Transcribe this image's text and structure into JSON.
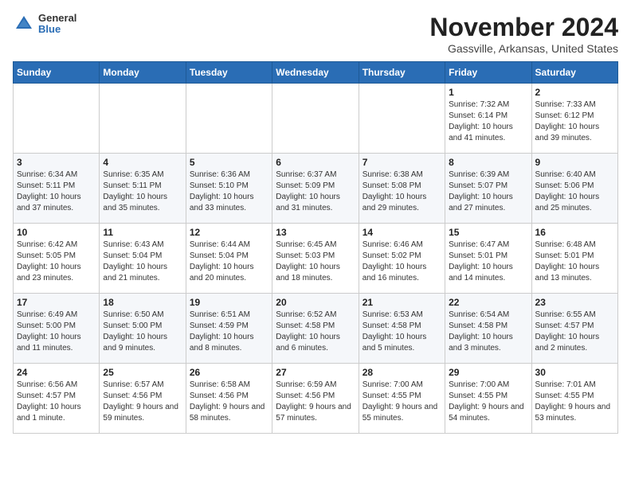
{
  "header": {
    "logo_general": "General",
    "logo_blue": "Blue",
    "month_title": "November 2024",
    "location": "Gassville, Arkansas, United States"
  },
  "weekdays": [
    "Sunday",
    "Monday",
    "Tuesday",
    "Wednesday",
    "Thursday",
    "Friday",
    "Saturday"
  ],
  "weeks": [
    [
      null,
      null,
      null,
      null,
      null,
      {
        "day": "1",
        "sunrise": "Sunrise: 7:32 AM",
        "sunset": "Sunset: 6:14 PM",
        "daylight": "Daylight: 10 hours and 41 minutes."
      },
      {
        "day": "2",
        "sunrise": "Sunrise: 7:33 AM",
        "sunset": "Sunset: 6:12 PM",
        "daylight": "Daylight: 10 hours and 39 minutes."
      }
    ],
    [
      {
        "day": "3",
        "sunrise": "Sunrise: 6:34 AM",
        "sunset": "Sunset: 5:11 PM",
        "daylight": "Daylight: 10 hours and 37 minutes."
      },
      {
        "day": "4",
        "sunrise": "Sunrise: 6:35 AM",
        "sunset": "Sunset: 5:11 PM",
        "daylight": "Daylight: 10 hours and 35 minutes."
      },
      {
        "day": "5",
        "sunrise": "Sunrise: 6:36 AM",
        "sunset": "Sunset: 5:10 PM",
        "daylight": "Daylight: 10 hours and 33 minutes."
      },
      {
        "day": "6",
        "sunrise": "Sunrise: 6:37 AM",
        "sunset": "Sunset: 5:09 PM",
        "daylight": "Daylight: 10 hours and 31 minutes."
      },
      {
        "day": "7",
        "sunrise": "Sunrise: 6:38 AM",
        "sunset": "Sunset: 5:08 PM",
        "daylight": "Daylight: 10 hours and 29 minutes."
      },
      {
        "day": "8",
        "sunrise": "Sunrise: 6:39 AM",
        "sunset": "Sunset: 5:07 PM",
        "daylight": "Daylight: 10 hours and 27 minutes."
      },
      {
        "day": "9",
        "sunrise": "Sunrise: 6:40 AM",
        "sunset": "Sunset: 5:06 PM",
        "daylight": "Daylight: 10 hours and 25 minutes."
      }
    ],
    [
      {
        "day": "10",
        "sunrise": "Sunrise: 6:42 AM",
        "sunset": "Sunset: 5:05 PM",
        "daylight": "Daylight: 10 hours and 23 minutes."
      },
      {
        "day": "11",
        "sunrise": "Sunrise: 6:43 AM",
        "sunset": "Sunset: 5:04 PM",
        "daylight": "Daylight: 10 hours and 21 minutes."
      },
      {
        "day": "12",
        "sunrise": "Sunrise: 6:44 AM",
        "sunset": "Sunset: 5:04 PM",
        "daylight": "Daylight: 10 hours and 20 minutes."
      },
      {
        "day": "13",
        "sunrise": "Sunrise: 6:45 AM",
        "sunset": "Sunset: 5:03 PM",
        "daylight": "Daylight: 10 hours and 18 minutes."
      },
      {
        "day": "14",
        "sunrise": "Sunrise: 6:46 AM",
        "sunset": "Sunset: 5:02 PM",
        "daylight": "Daylight: 10 hours and 16 minutes."
      },
      {
        "day": "15",
        "sunrise": "Sunrise: 6:47 AM",
        "sunset": "Sunset: 5:01 PM",
        "daylight": "Daylight: 10 hours and 14 minutes."
      },
      {
        "day": "16",
        "sunrise": "Sunrise: 6:48 AM",
        "sunset": "Sunset: 5:01 PM",
        "daylight": "Daylight: 10 hours and 13 minutes."
      }
    ],
    [
      {
        "day": "17",
        "sunrise": "Sunrise: 6:49 AM",
        "sunset": "Sunset: 5:00 PM",
        "daylight": "Daylight: 10 hours and 11 minutes."
      },
      {
        "day": "18",
        "sunrise": "Sunrise: 6:50 AM",
        "sunset": "Sunset: 5:00 PM",
        "daylight": "Daylight: 10 hours and 9 minutes."
      },
      {
        "day": "19",
        "sunrise": "Sunrise: 6:51 AM",
        "sunset": "Sunset: 4:59 PM",
        "daylight": "Daylight: 10 hours and 8 minutes."
      },
      {
        "day": "20",
        "sunrise": "Sunrise: 6:52 AM",
        "sunset": "Sunset: 4:58 PM",
        "daylight": "Daylight: 10 hours and 6 minutes."
      },
      {
        "day": "21",
        "sunrise": "Sunrise: 6:53 AM",
        "sunset": "Sunset: 4:58 PM",
        "daylight": "Daylight: 10 hours and 5 minutes."
      },
      {
        "day": "22",
        "sunrise": "Sunrise: 6:54 AM",
        "sunset": "Sunset: 4:58 PM",
        "daylight": "Daylight: 10 hours and 3 minutes."
      },
      {
        "day": "23",
        "sunrise": "Sunrise: 6:55 AM",
        "sunset": "Sunset: 4:57 PM",
        "daylight": "Daylight: 10 hours and 2 minutes."
      }
    ],
    [
      {
        "day": "24",
        "sunrise": "Sunrise: 6:56 AM",
        "sunset": "Sunset: 4:57 PM",
        "daylight": "Daylight: 10 hours and 1 minute."
      },
      {
        "day": "25",
        "sunrise": "Sunrise: 6:57 AM",
        "sunset": "Sunset: 4:56 PM",
        "daylight": "Daylight: 9 hours and 59 minutes."
      },
      {
        "day": "26",
        "sunrise": "Sunrise: 6:58 AM",
        "sunset": "Sunset: 4:56 PM",
        "daylight": "Daylight: 9 hours and 58 minutes."
      },
      {
        "day": "27",
        "sunrise": "Sunrise: 6:59 AM",
        "sunset": "Sunset: 4:56 PM",
        "daylight": "Daylight: 9 hours and 57 minutes."
      },
      {
        "day": "28",
        "sunrise": "Sunrise: 7:00 AM",
        "sunset": "Sunset: 4:55 PM",
        "daylight": "Daylight: 9 hours and 55 minutes."
      },
      {
        "day": "29",
        "sunrise": "Sunrise: 7:00 AM",
        "sunset": "Sunset: 4:55 PM",
        "daylight": "Daylight: 9 hours and 54 minutes."
      },
      {
        "day": "30",
        "sunrise": "Sunrise: 7:01 AM",
        "sunset": "Sunset: 4:55 PM",
        "daylight": "Daylight: 9 hours and 53 minutes."
      }
    ]
  ]
}
